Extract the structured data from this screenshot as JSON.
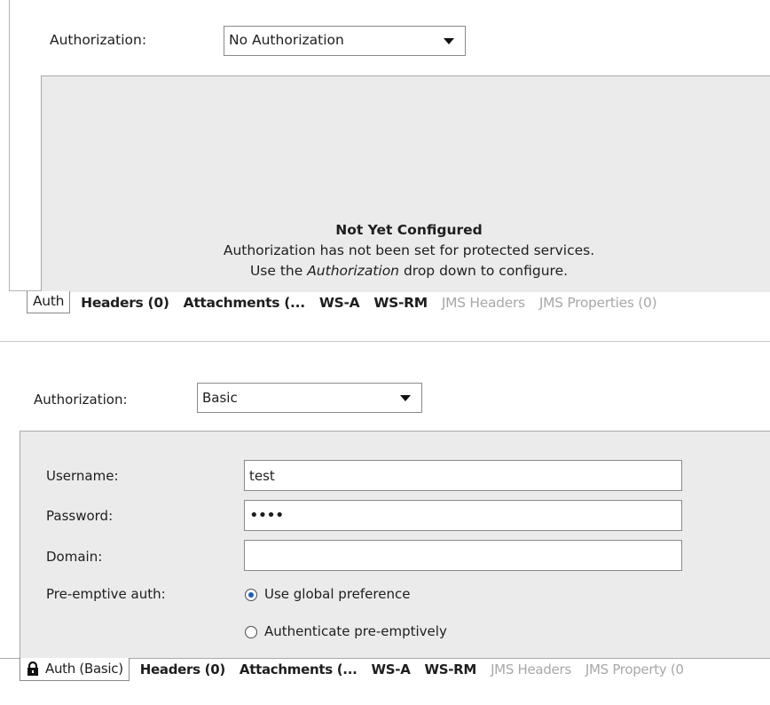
{
  "panel1": {
    "auth_label": "Authorization:",
    "auth_value": "No Authorization",
    "notice_title": "Not Yet Configured",
    "notice_line1": "Authorization has not been set for protected services.",
    "notice_line2_pre": "Use the ",
    "notice_line2_em": "Authorization",
    "notice_line2_post": " drop down to configure.",
    "tabs": [
      "Auth",
      "Headers (0)",
      "Attachments (...",
      "WS-A",
      "WS-RM",
      "JMS Headers",
      "JMS Properties (0)"
    ]
  },
  "panel2": {
    "auth_label": "Authorization:",
    "auth_value": "Basic",
    "username_label": "Username:",
    "username_value": "test",
    "password_label": "Password:",
    "password_value": "••••",
    "domain_label": "Domain:",
    "domain_value": "",
    "preemptive_label": "Pre-emptive auth:",
    "radio_global": "Use global preference",
    "radio_preemptive": "Authenticate pre-emptively",
    "tabs": [
      "Auth (Basic)",
      "Headers (0)",
      "Attachments (...",
      "WS-A",
      "WS-RM",
      "JMS Headers",
      "JMS Property (0"
    ],
    "tab_icon": "lock-icon"
  },
  "colors": {
    "panel_bg": "#ebebeb",
    "border": "#a9a9a9",
    "disabled_text": "#a8a8a8",
    "radio_dot": "#1a5fb4"
  }
}
